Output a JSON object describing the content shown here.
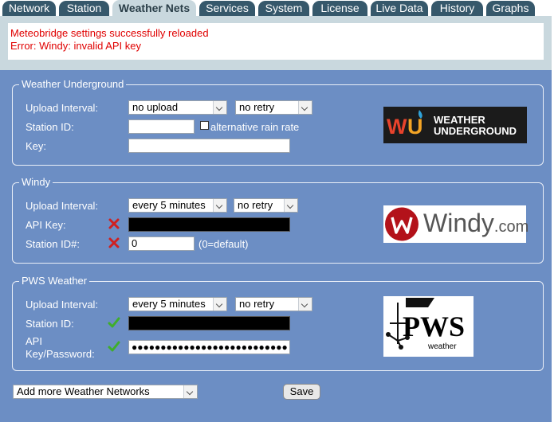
{
  "tabs": [
    {
      "label": "Network",
      "active": false
    },
    {
      "label": "Station",
      "active": false
    },
    {
      "label": "Weather Nets",
      "active": true
    },
    {
      "label": "Services",
      "active": false
    },
    {
      "label": "System",
      "active": false
    },
    {
      "label": "License",
      "active": false
    },
    {
      "label": "Live Data",
      "active": false
    },
    {
      "label": "History",
      "active": false
    },
    {
      "label": "Graphs",
      "active": false
    }
  ],
  "messages": {
    "line1": "Meteobridge settings successfully reloaded",
    "line2": "Error: Windy: invalid API key",
    "color": "#e00000"
  },
  "wunderground": {
    "legend": "Weather Underground",
    "upload_interval_label": "Upload Interval:",
    "upload_interval_value": "no upload",
    "retry_value": "no retry",
    "station_id_label": "Station ID:",
    "station_id_value": "",
    "alt_rain_label": "alternative rain rate",
    "alt_rain_checked": false,
    "key_label": "Key:",
    "key_value": "",
    "logo_line1": "WEATHER",
    "logo_line2": "UNDERGROUND"
  },
  "windy": {
    "legend": "Windy",
    "upload_interval_label": "Upload Interval:",
    "upload_interval_value": "every 5 minutes",
    "retry_value": "no retry",
    "api_key_label": "API Key:",
    "api_key_status": "invalid",
    "station_label": "Station ID#:",
    "station_value": "0",
    "station_status": "invalid",
    "station_hint": "(0=default)",
    "logo_text": "Windy",
    "logo_suffix": ".com"
  },
  "pws": {
    "legend": "PWS Weather",
    "upload_interval_label": "Upload Interval:",
    "upload_interval_value": "every 5 minutes",
    "retry_value": "no retry",
    "station_id_label": "Station ID:",
    "station_id_status": "valid",
    "api_key_label_line1": "API",
    "api_key_label_line2": "Key/Password:",
    "api_key_status": "valid",
    "api_key_mask": "●●●●●●●●●●●●●●●●●●●●●●●●●●●",
    "logo_big": "PWS",
    "logo_small": "weather"
  },
  "footer": {
    "add_networks": "Add more Weather Networks",
    "save_label": "Save"
  },
  "colors": {
    "panel_bg": "#6c8ec4",
    "tab_bg": "#36586b",
    "band_bg": "#c9d8de",
    "error_red": "#e00000",
    "ok_green": "#3fae2a",
    "bad_red": "#d02020"
  }
}
